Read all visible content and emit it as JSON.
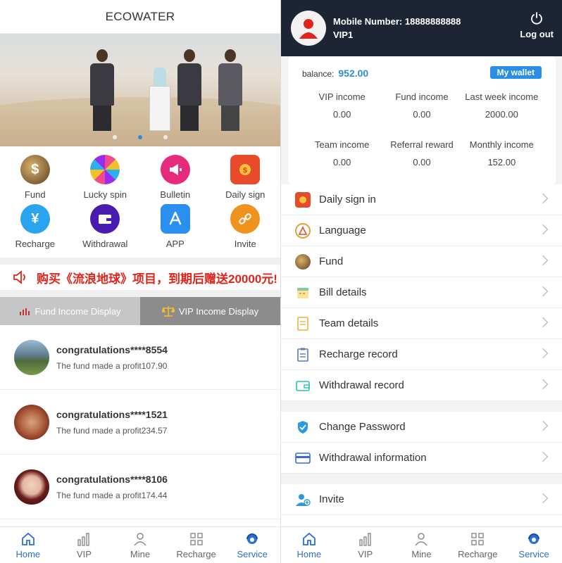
{
  "left": {
    "title": "ECOWATER",
    "grid": [
      {
        "label": "Fund",
        "icon": "fund-icon",
        "color": "#8a6b3f"
      },
      {
        "label": "Lucky spin",
        "icon": "lucky-spin-icon",
        "color": "#e34c9c"
      },
      {
        "label": "Bulletin",
        "icon": "megaphone-icon",
        "color": "#e62a7c"
      },
      {
        "label": "Daily sign",
        "icon": "daily-sign-icon",
        "color": "#e84a2c"
      },
      {
        "label": "Recharge",
        "icon": "yen-icon",
        "color": "#2aa4ef"
      },
      {
        "label": "Withdrawal",
        "icon": "wallet-icon",
        "color": "#4a1bb0"
      },
      {
        "label": "APP",
        "icon": "app-store-icon",
        "color": "#2a8ff0"
      },
      {
        "label": "Invite",
        "icon": "link-icon",
        "color": "#f0921e"
      }
    ],
    "marquee": "购买《流浪地球》项目，到期后赠送20000元!",
    "tabs": {
      "fund": "Fund Income Display",
      "vip": "VIP Income Display"
    },
    "feed": [
      {
        "title": "congratulations****8554",
        "sub": "The fund made a profit107.90"
      },
      {
        "title": "congratulations****1521",
        "sub": "The fund made a profit234.57"
      },
      {
        "title": "congratulations****8106",
        "sub": "The fund made a profit174.44"
      }
    ]
  },
  "nav": {
    "home": "Home",
    "vip": "VIP",
    "mine": "Mine",
    "recharge": "Recharge",
    "service": "Service"
  },
  "right": {
    "mobile_label": "Mobile Number:",
    "mobile": "18888888888",
    "vip": "VIP1",
    "logout": "Log out",
    "balance_label": "balance:",
    "balance": "952.00",
    "my_wallet": "My wallet",
    "stats": [
      {
        "label": "VIP income",
        "value": "0.00"
      },
      {
        "label": "Fund income",
        "value": "0.00"
      },
      {
        "label": "Last week income",
        "value": "2000.00"
      },
      {
        "label": "Team income",
        "value": "0.00"
      },
      {
        "label": "Referral reward",
        "value": "0.00"
      },
      {
        "label": "Monthly income",
        "value": "152.00"
      }
    ],
    "menu1": [
      "Daily sign in",
      "Language",
      "Fund",
      "Bill details",
      "Team details",
      "Recharge record",
      "Withdrawal record"
    ],
    "menu2": [
      "Change Password",
      "Withdrawal information"
    ],
    "menu3": [
      "Invite"
    ]
  },
  "colors": {
    "accent": "#2a6fd4",
    "header_bg": "#1d2535",
    "marquee_red": "#e0241b"
  }
}
